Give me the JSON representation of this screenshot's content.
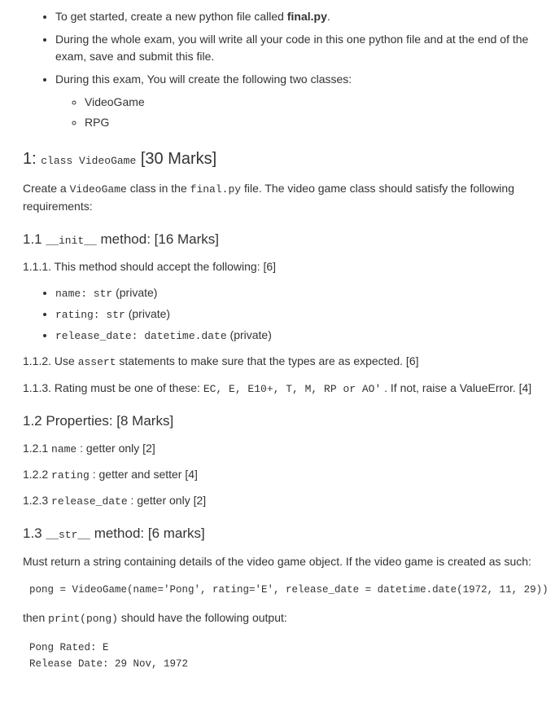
{
  "intro": {
    "items": [
      {
        "prefix": "To get started, create a new python file called ",
        "bold": "final.py",
        "suffix": "."
      },
      {
        "prefix": "During the whole exam, you will write all your code in this one python file and at the end of the exam, save and submit this file.",
        "bold": "",
        "suffix": ""
      },
      {
        "prefix": "During this exam, You will create the following two classes:",
        "bold": "",
        "suffix": ""
      }
    ],
    "classes": [
      "VideoGame",
      "RPG"
    ]
  },
  "section1": {
    "heading_pre": "1: ",
    "heading_code": "class VideoGame",
    "heading_post": " [30 Marks]",
    "intro_pre": "Create a ",
    "intro_code1": "VideoGame",
    "intro_mid": " class in the ",
    "intro_code2": "final.py",
    "intro_post": " file. The video game class should satisfy the following requirements:"
  },
  "s11": {
    "heading_pre": "1.1 ",
    "heading_code": "__init__",
    "heading_post": " method: [16 Marks]",
    "p111": "1.1.1. This method should accept the following: [6]",
    "params": [
      {
        "code": "name: str",
        "text": " (private)"
      },
      {
        "code": "rating: str",
        "text": " (private)"
      },
      {
        "code": "release_date: datetime.date",
        "text": " (private)"
      }
    ],
    "p112_pre": "1.1.2. Use ",
    "p112_code": "assert",
    "p112_post": " statements to make sure that the types are as expected. [6]",
    "p113_pre": "1.1.3. Rating must be one of these: ",
    "p113_code": "EC, E, E10+, T, M, RP or AO'",
    "p113_post": " . If not, raise a ValueError. [4]"
  },
  "s12": {
    "heading": "1.2 Properties: [8 Marks]",
    "items": [
      {
        "num": "1.2.1 ",
        "code": "name",
        "text": " : getter only [2]"
      },
      {
        "num": "1.2.2 ",
        "code": "rating",
        "text": " : getter and setter [4]"
      },
      {
        "num": "1.2.3 ",
        "code": "release_date",
        "text": " : getter only [2]"
      }
    ]
  },
  "s13": {
    "heading_pre": "1.3 ",
    "heading_code": "__str__",
    "heading_post": " method: [6 marks]",
    "p1": "Must return a string containing details of the video game object. If the video game is created as such:",
    "code1": "pong = VideoGame(name='Pong', rating='E', release_date = datetime.date(1972, 11, 29))",
    "p2_pre": "then ",
    "p2_code": "print(pong)",
    "p2_post": " should have the following output:",
    "code2": "Pong Rated: E\nRelease Date: 29 Nov, 1972"
  }
}
